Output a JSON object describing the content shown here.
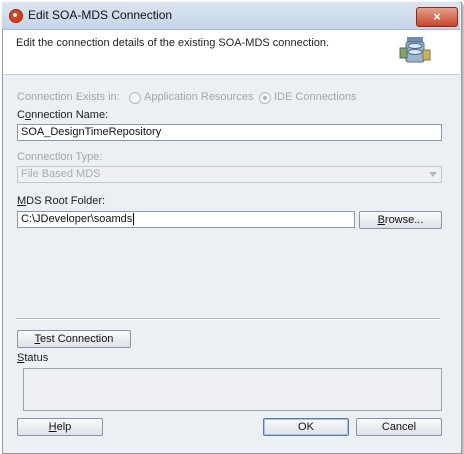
{
  "window": {
    "title": "Edit SOA-MDS Connection",
    "close_label": "×"
  },
  "header": {
    "description": "Edit the connection details of the existing SOA-MDS connection.",
    "icon": "database-connection-icon"
  },
  "connection_exists": {
    "label": "Connection Exists in:",
    "options": [
      "Application Resources",
      "IDE Connections"
    ],
    "selected": "IDE Connections"
  },
  "connection_name": {
    "label_mnemonic": "o",
    "label_prefix": "C",
    "label_suffix": "nnection Name:",
    "value": "SOA_DesignTimeRepository"
  },
  "connection_type": {
    "label": "Connection Type:",
    "value": "File Based MDS"
  },
  "mds_root": {
    "label_mnemonic": "M",
    "label_suffix": "DS Root Folder:",
    "value": "C:\\JDeveloper\\soamds"
  },
  "buttons": {
    "browse_m": "B",
    "browse_rest": "rowse...",
    "test_m": "T",
    "test_rest": "est Connection",
    "help_m": "H",
    "help_rest": "elp",
    "ok": "OK",
    "cancel": "Cancel"
  },
  "status": {
    "label_m": "S",
    "label_rest": "tatus",
    "text": ""
  }
}
